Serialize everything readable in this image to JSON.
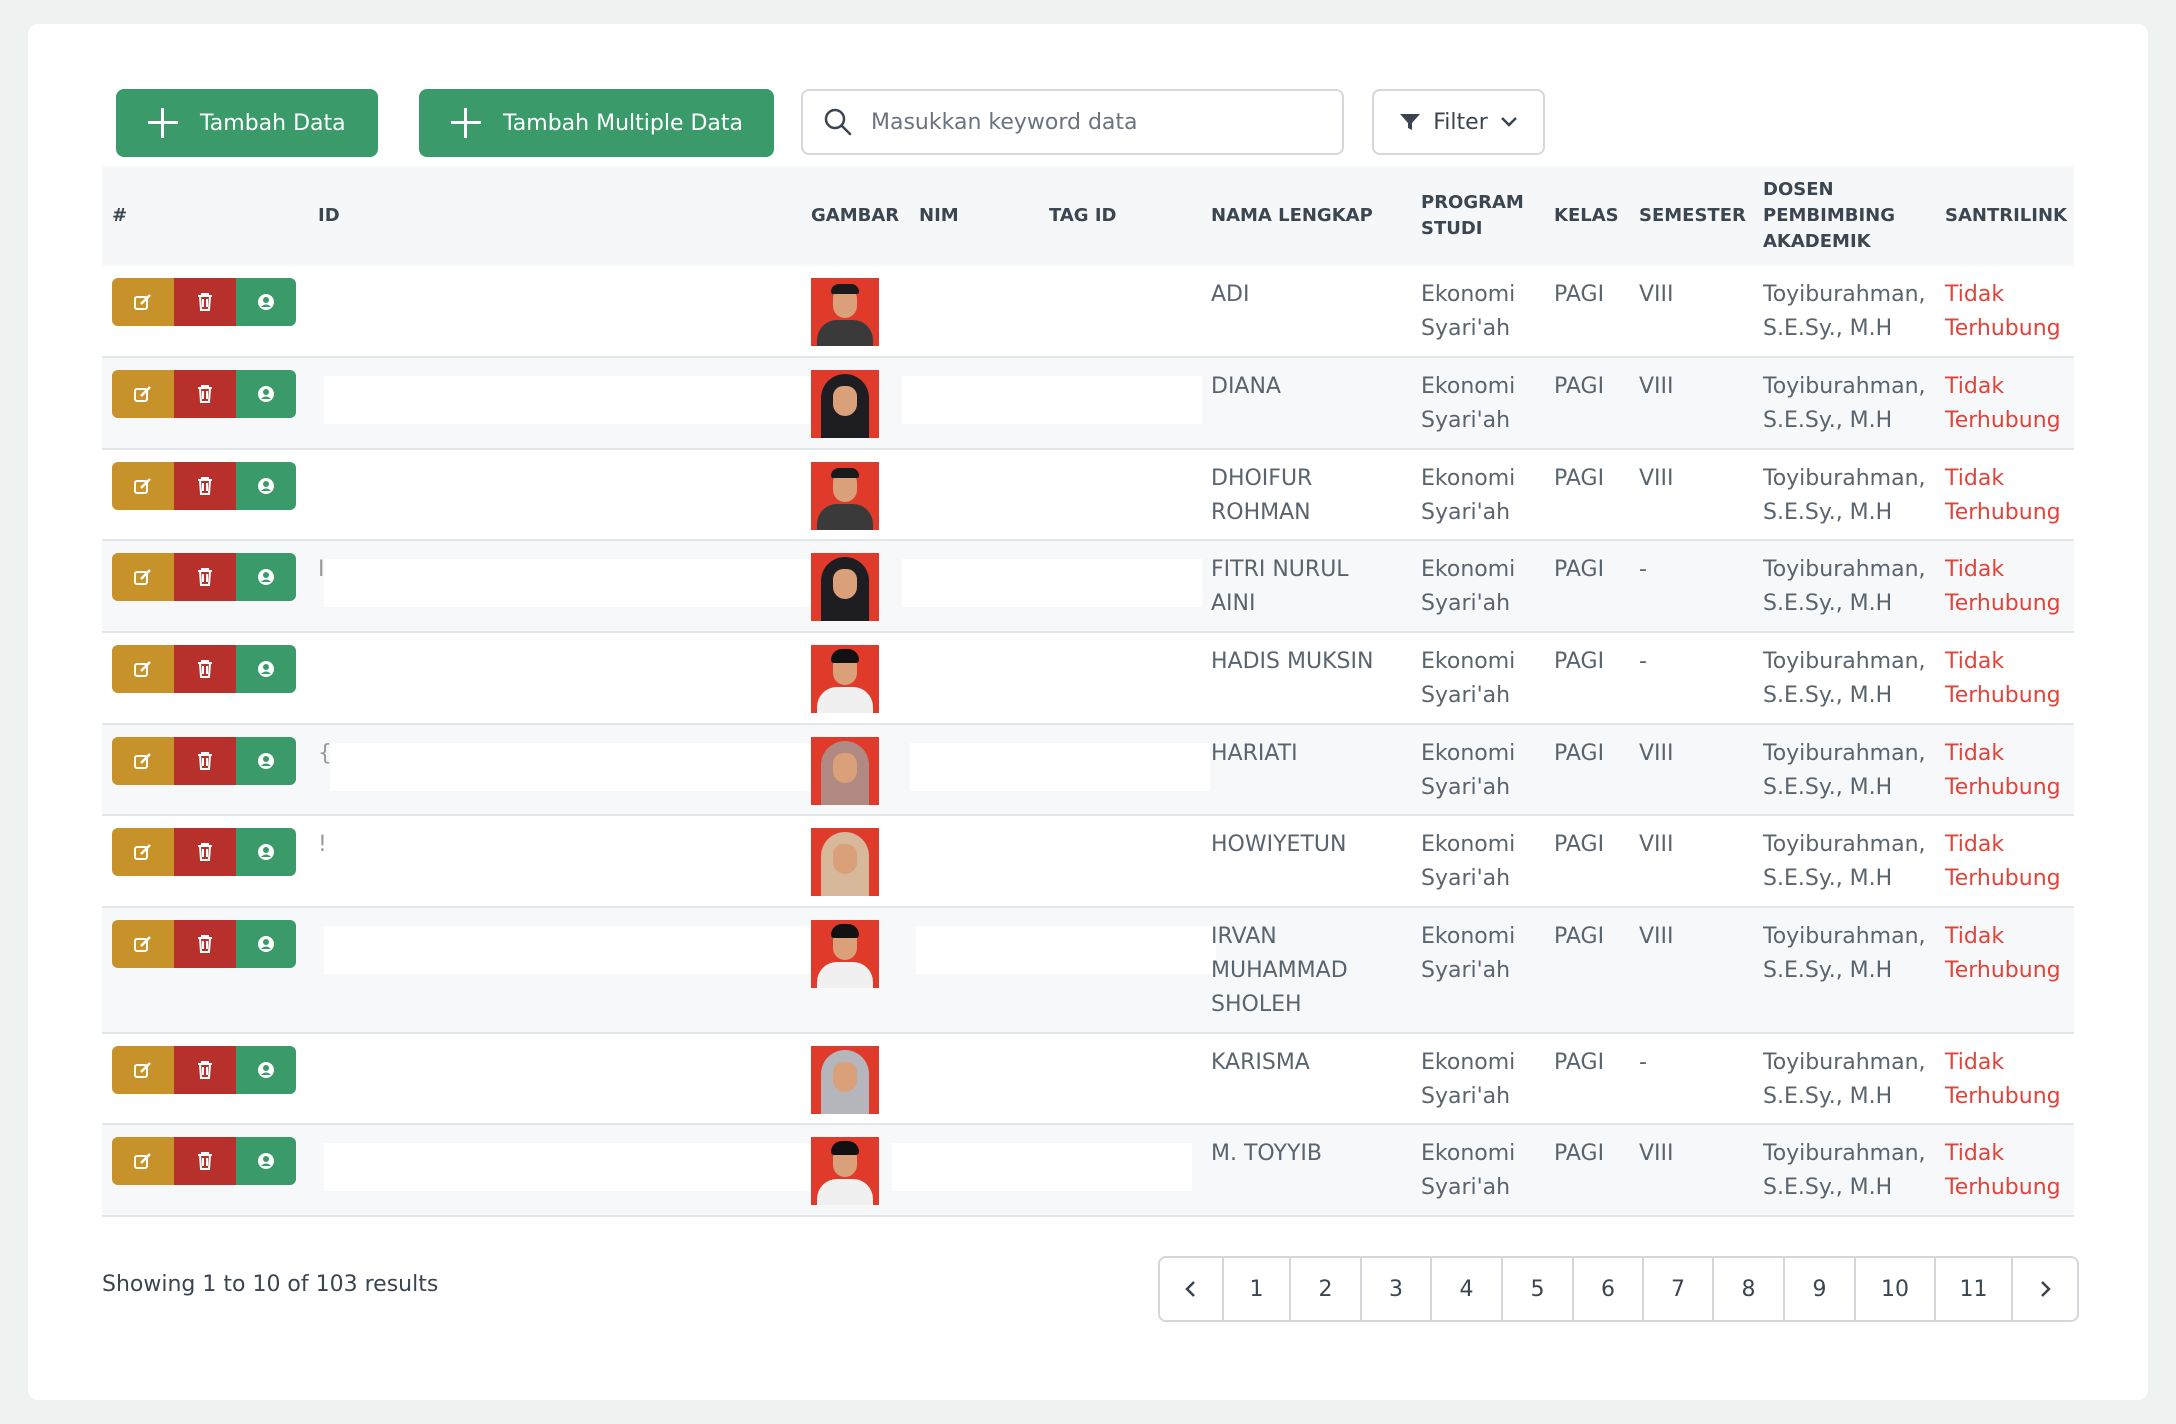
{
  "toolbar": {
    "add_label": "Tambah Data",
    "add_multiple_label": "Tambah Multiple Data",
    "search_placeholder": "Masukkan keyword data",
    "filter_label": "Filter"
  },
  "table": {
    "headers": {
      "index": "#",
      "id": "ID",
      "image": "GAMBAR",
      "nim": "NIM",
      "tag_id": "TAG ID",
      "full_name": "NAMA LENGKAP",
      "program_line1": "PROGRAM",
      "program_line2": "STUDI",
      "class": "KELAS",
      "semester": "SEMESTER",
      "advisor_line1": "DOSEN",
      "advisor_line2": "PEMBIMBING",
      "advisor_line3": "AKADEMIK",
      "santrilink": "SANTRILINK"
    },
    "rows": [
      {
        "name_l1": "ADI",
        "name_l2": "",
        "name_l3": "",
        "program_l1": "Ekonomi",
        "program_l2": "Syari'ah",
        "class": "PAGI",
        "semester": "VIII",
        "advisor_l1": "Toyiburahman,",
        "advisor_l2": "S.E.Sy., M.H",
        "link_l1": "Tidak",
        "link_l2": "Terhubung",
        "id_glyph": ""
      },
      {
        "name_l1": "DIANA",
        "name_l2": "",
        "name_l3": "",
        "program_l1": "Ekonomi",
        "program_l2": "Syari'ah",
        "class": "PAGI",
        "semester": "VIII",
        "advisor_l1": "Toyiburahman,",
        "advisor_l2": "S.E.Sy., M.H",
        "link_l1": "Tidak",
        "link_l2": "Terhubung",
        "id_glyph": ""
      },
      {
        "name_l1": "DHOIFUR",
        "name_l2": "ROHMAN",
        "name_l3": "",
        "program_l1": "Ekonomi",
        "program_l2": "Syari'ah",
        "class": "PAGI",
        "semester": "VIII",
        "advisor_l1": "Toyiburahman,",
        "advisor_l2": "S.E.Sy., M.H",
        "link_l1": "Tidak",
        "link_l2": "Terhubung",
        "id_glyph": ""
      },
      {
        "name_l1": "FITRI NURUL",
        "name_l2": "AINI",
        "name_l3": "",
        "program_l1": "Ekonomi",
        "program_l2": "Syari'ah",
        "class": "PAGI",
        "semester": "-",
        "advisor_l1": "Toyiburahman,",
        "advisor_l2": "S.E.Sy., M.H",
        "link_l1": "Tidak",
        "link_l2": "Terhubung",
        "id_glyph": "I"
      },
      {
        "name_l1": "HADIS MUKSIN",
        "name_l2": "",
        "name_l3": "",
        "program_l1": "Ekonomi",
        "program_l2": "Syari'ah",
        "class": "PAGI",
        "semester": "-",
        "advisor_l1": "Toyiburahman,",
        "advisor_l2": "S.E.Sy., M.H",
        "link_l1": "Tidak",
        "link_l2": "Terhubung",
        "id_glyph": ""
      },
      {
        "name_l1": "HARIATI",
        "name_l2": "",
        "name_l3": "",
        "program_l1": "Ekonomi",
        "program_l2": "Syari'ah",
        "class": "PAGI",
        "semester": "VIII",
        "advisor_l1": "Toyiburahman,",
        "advisor_l2": "S.E.Sy., M.H",
        "link_l1": "Tidak",
        "link_l2": "Terhubung",
        "id_glyph": "{"
      },
      {
        "name_l1": "HOWIYETUN",
        "name_l2": "",
        "name_l3": "",
        "program_l1": "Ekonomi",
        "program_l2": "Syari'ah",
        "class": "PAGI",
        "semester": "VIII",
        "advisor_l1": "Toyiburahman,",
        "advisor_l2": "S.E.Sy., M.H",
        "link_l1": "Tidak",
        "link_l2": "Terhubung",
        "id_glyph": "!"
      },
      {
        "name_l1": "IRVAN",
        "name_l2": "MUHAMMAD",
        "name_l3": "SHOLEH",
        "program_l1": "Ekonomi",
        "program_l2": "Syari'ah",
        "class": "PAGI",
        "semester": "VIII",
        "advisor_l1": "Toyiburahman,",
        "advisor_l2": "S.E.Sy., M.H",
        "link_l1": "Tidak",
        "link_l2": "Terhubung",
        "id_glyph": ""
      },
      {
        "name_l1": "KARISMA",
        "name_l2": "",
        "name_l3": "",
        "program_l1": "Ekonomi",
        "program_l2": "Syari'ah",
        "class": "PAGI",
        "semester": "-",
        "advisor_l1": "Toyiburahman,",
        "advisor_l2": "S.E.Sy., M.H",
        "link_l1": "Tidak",
        "link_l2": "Terhubung",
        "id_glyph": ""
      },
      {
        "name_l1": "M. TOYYIB",
        "name_l2": "",
        "name_l3": "",
        "program_l1": "Ekonomi",
        "program_l2": "Syari'ah",
        "class": "PAGI",
        "semester": "VIII",
        "advisor_l1": "Toyiburahman,",
        "advisor_l2": "S.E.Sy., M.H",
        "link_l1": "Tidak",
        "link_l2": "Terhubung",
        "id_glyph": ""
      }
    ]
  },
  "footer": {
    "showing": "Showing 1 to 10 of 103 results",
    "pages": [
      "1",
      "2",
      "3",
      "4",
      "5",
      "6",
      "7",
      "8",
      "9",
      "10",
      "11"
    ]
  },
  "colors": {
    "primary_green": "#3a9a6a",
    "edit_gold": "#c8922a",
    "delete_red": "#b7302c",
    "link_red": "#e0443a"
  },
  "icons": [
    "plus-icon",
    "search-icon",
    "filter-icon",
    "chevron-down-icon",
    "edit-icon",
    "trash-icon",
    "user-icon",
    "chevron-left-icon",
    "chevron-right-icon"
  ]
}
